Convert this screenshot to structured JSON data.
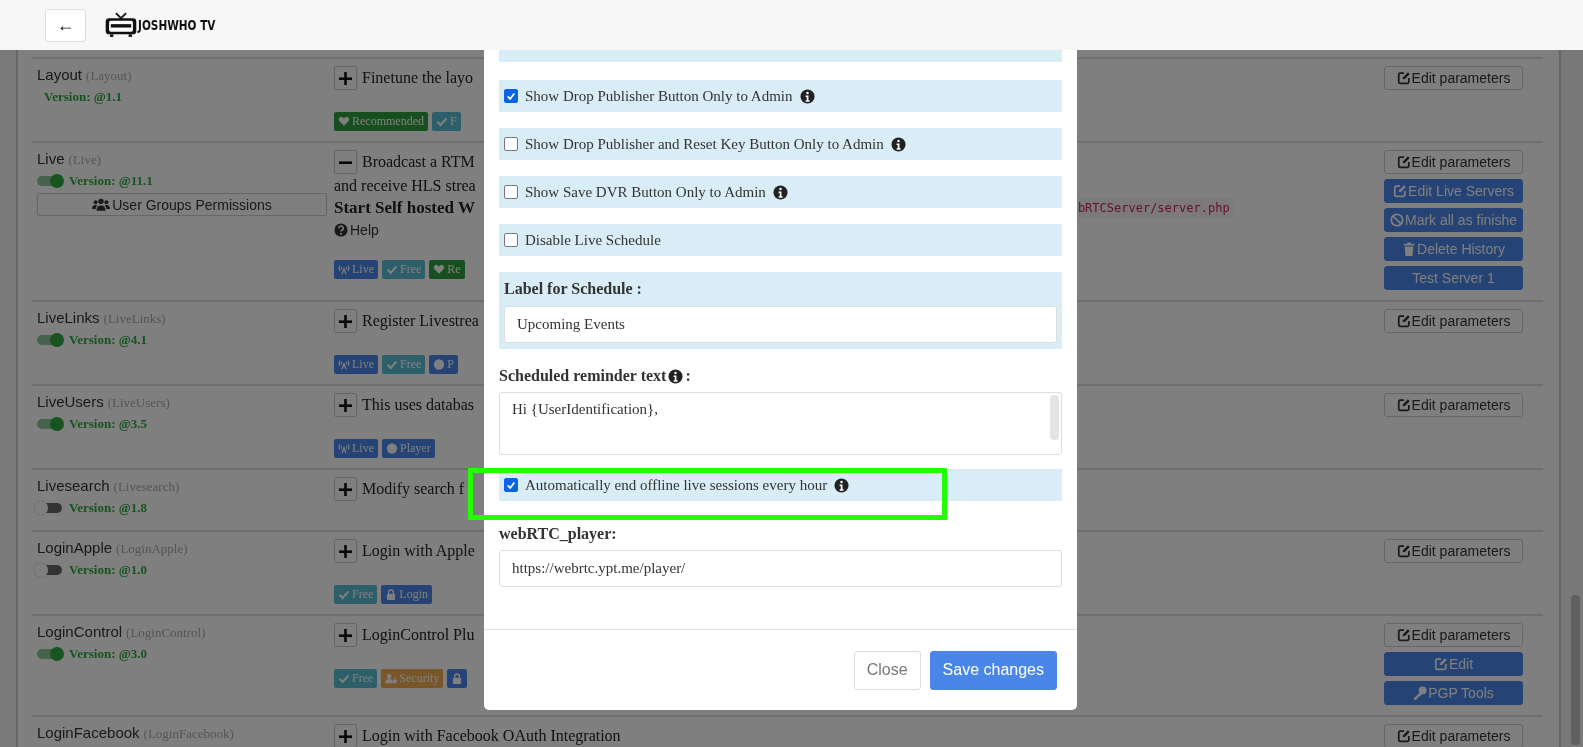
{
  "header": {
    "back_label": "←",
    "logo_text": "JOSHWHO TV"
  },
  "plugins": [
    {
      "name": "Layout",
      "slug": "(Layout)",
      "version": "Version: @1.1",
      "expanded": false,
      "summary": "Finetune the layo",
      "tags": [
        {
          "kind": "recommended",
          "label": "Recommended"
        },
        {
          "kind": "free",
          "label": "F"
        }
      ],
      "buttons": [
        {
          "kind": "parameters",
          "label": "Edit parameters"
        }
      ]
    },
    {
      "name": "Live",
      "slug": "(Live)",
      "enabled": true,
      "version": "Version: @11.1",
      "permissions_button": "User Groups Permissions",
      "expanded": true,
      "summary": "Broadcast a RTM",
      "lines": [
        {
          "kind": "text",
          "text": "and receive HLS strea"
        },
        {
          "kind": "bold",
          "text": "Start Self hosted W",
          "code": "bRTCServer/server.php"
        },
        {
          "kind": "help",
          "text": "Help"
        }
      ],
      "tags": [
        {
          "kind": "live",
          "label": "Live"
        },
        {
          "kind": "free",
          "label": "Free"
        },
        {
          "kind": "recommended",
          "label": "Re"
        }
      ],
      "buttons": [
        {
          "kind": "parameters",
          "label": "Edit parameters"
        },
        {
          "kind": "edit",
          "label": "Edit Live Servers"
        },
        {
          "kind": "mark",
          "label": "Mark all as finishe"
        },
        {
          "kind": "delete",
          "label": "Delete History"
        },
        {
          "kind": "test",
          "label": "Test Server 1"
        }
      ]
    },
    {
      "name": "LiveLinks",
      "slug": "(LiveLinks)",
      "enabled": true,
      "version": "Version: @4.1",
      "expanded": false,
      "summary": "Register Livestrea",
      "tags": [
        {
          "kind": "live",
          "label": "Live"
        },
        {
          "kind": "free",
          "label": "Free"
        },
        {
          "kind": "player",
          "label": "P"
        }
      ],
      "buttons": [
        {
          "kind": "parameters",
          "label": "Edit parameters"
        }
      ]
    },
    {
      "name": "LiveUsers",
      "slug": "(LiveUsers)",
      "enabled": true,
      "version": "Version: @3.5",
      "expanded": false,
      "summary": "This uses databas",
      "tags": [
        {
          "kind": "live",
          "label": "Live"
        },
        {
          "kind": "player",
          "label": "Player"
        }
      ],
      "buttons": [
        {
          "kind": "parameters",
          "label": "Edit parameters"
        }
      ]
    },
    {
      "name": "Livesearch",
      "slug": "(Livesearch)",
      "enabled": false,
      "version": "Version: @1.8",
      "expanded": false,
      "summary": "Modify search f"
    },
    {
      "name": "LoginApple",
      "slug": "(LoginApple)",
      "enabled": false,
      "version": "Version: @1.0",
      "expanded": false,
      "summary": "Login with Apple",
      "tags": [
        {
          "kind": "free",
          "label": "Free"
        },
        {
          "kind": "login",
          "label": "Login"
        }
      ],
      "buttons": [
        {
          "kind": "parameters",
          "label": "Edit parameters"
        }
      ]
    },
    {
      "name": "LoginControl",
      "slug": "(LoginControl)",
      "enabled": true,
      "version": "Version: @3.0",
      "expanded": false,
      "summary": "LoginControl Plu",
      "tags": [
        {
          "kind": "free",
          "label": "Free"
        },
        {
          "kind": "security",
          "label": "Security"
        },
        {
          "kind": "login"
        }
      ],
      "buttons": [
        {
          "kind": "parameters",
          "label": "Edit parameters"
        },
        {
          "kind": "edit",
          "label": "Edit"
        },
        {
          "kind": "tools",
          "label": "PGP Tools"
        }
      ]
    },
    {
      "name": "LoginFacebook",
      "slug": "(LoginFacebook)",
      "expanded": false,
      "summary": "Login with Facebook OAuth Integration",
      "buttons": [
        {
          "kind": "parameters",
          "label": "Edit parameters"
        }
      ]
    }
  ],
  "modal": {
    "fields": [
      {
        "kind": "cut"
      },
      {
        "kind": "checkbox",
        "label": "Show Drop Publisher Button Only to Admin",
        "checked": true,
        "info": true,
        "highlighted": false
      },
      {
        "kind": "checkbox",
        "label": "Show Drop Publisher and Reset Key Button Only to Admin",
        "checked": false,
        "info": true,
        "highlighted": false
      },
      {
        "kind": "checkbox",
        "label": "Show Save DVR Button Only to Admin",
        "checked": false,
        "info": true,
        "highlighted": false
      },
      {
        "kind": "checkbox",
        "label": "Disable Live Schedule",
        "checked": false,
        "info": false,
        "highlighted": false
      },
      {
        "kind": "panel-input",
        "label": "Label for Schedule :",
        "value": "Upcoming Events"
      },
      {
        "kind": "textarea",
        "label": "Scheduled reminder text",
        "info": true,
        "suffix": ":",
        "value": "Hi {UserIdentification},"
      },
      {
        "kind": "checkbox",
        "label": "Automatically end offline live sessions every hour",
        "checked": true,
        "info": true,
        "highlighted": true
      },
      {
        "kind": "input",
        "label": "webRTC_player:",
        "value": "https://webrtc.ypt.me/player/"
      }
    ],
    "buttons": [
      {
        "kind": "secondary",
        "label": "Close"
      },
      {
        "kind": "primary",
        "label": "Save changes"
      }
    ]
  }
}
